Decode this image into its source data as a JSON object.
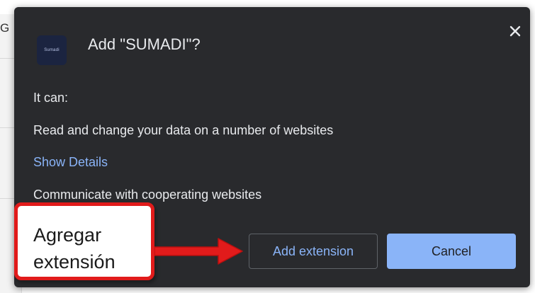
{
  "background": {
    "partial_text": "GE"
  },
  "dialog": {
    "title": "Add \"SUMADI\"?",
    "extension_icon": {
      "icon_name": "sumadi-logo-icon",
      "text": "Sumadi"
    },
    "close_icon": "close-icon",
    "permissions_heading": "It can:",
    "permissions": [
      "Read and change your data on a number of websites",
      "Communicate with cooperating websites"
    ],
    "show_details_label": "Show Details",
    "add_button_label": "Add extension",
    "cancel_button_label": "Cancel"
  },
  "annotation": {
    "line1": "Agregar",
    "line2": "extensión",
    "border_color": "#e11b1b",
    "arrow_color": "#e11b1b"
  },
  "colors": {
    "dialog_background": "#292a2d",
    "text": "#e8eaed",
    "link": "#8ab4f8",
    "primary_button": "#8ab4f8"
  }
}
